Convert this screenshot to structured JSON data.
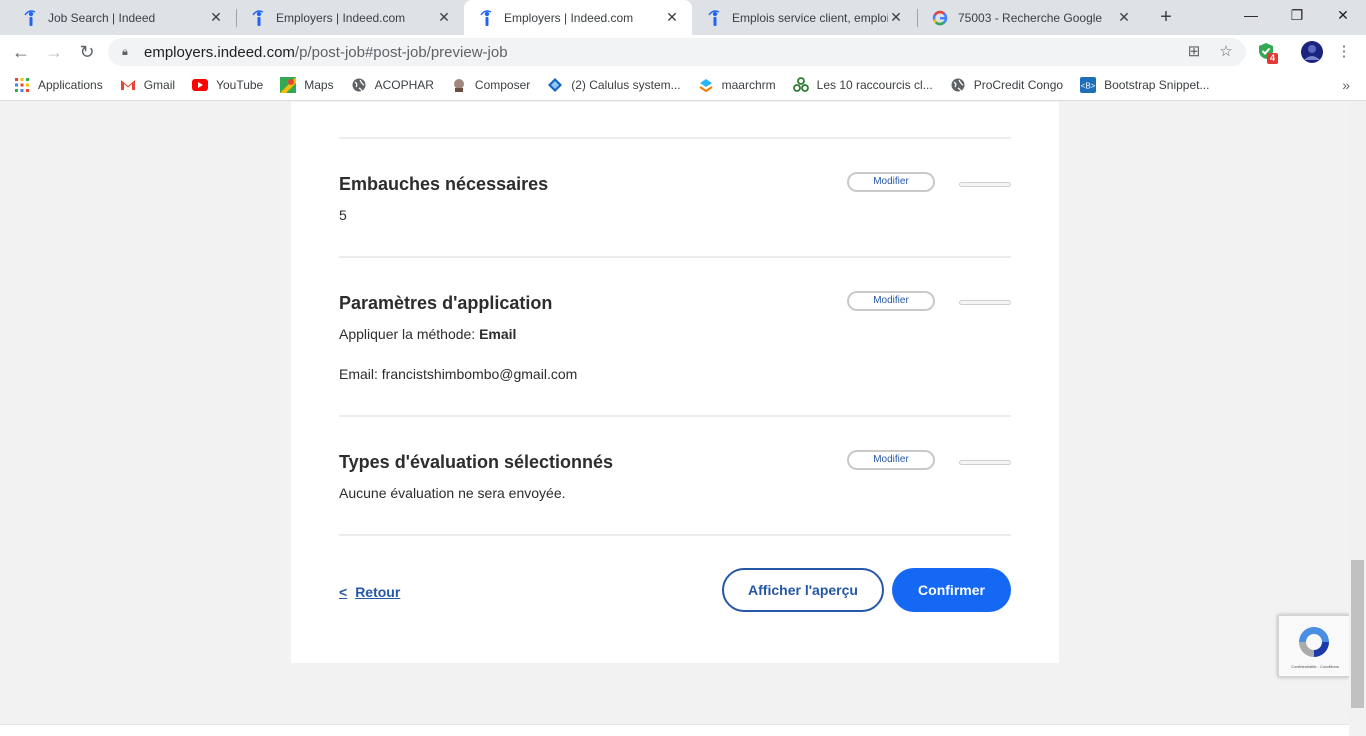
{
  "browser": {
    "tabs": [
      {
        "title": "Job Search | Indeed",
        "icon": "indeed-icon"
      },
      {
        "title": "Employers | Indeed.com",
        "icon": "indeed-icon"
      },
      {
        "title": "Employers | Indeed.com",
        "icon": "indeed-icon",
        "active": true
      },
      {
        "title": "Emplois service client, emploi | ",
        "icon": "indeed-icon"
      },
      {
        "title": "75003 - Recherche Google",
        "icon": "google-icon"
      }
    ],
    "url_host": "employers.indeed.com",
    "url_path": "/p/post-job#post-job/preview-job",
    "extension_badge": "4"
  },
  "bookmarks": [
    {
      "label": "Applications",
      "icon": "apps-grid-icon"
    },
    {
      "label": "Gmail",
      "icon": "gmail-icon"
    },
    {
      "label": "YouTube",
      "icon": "youtube-icon"
    },
    {
      "label": "Maps",
      "icon": "maps-icon"
    },
    {
      "label": "ACOPHAR",
      "icon": "globe-icon"
    },
    {
      "label": "Composer",
      "icon": "composer-icon"
    },
    {
      "label": "(2) Calulus system...",
      "icon": "calculus-icon"
    },
    {
      "label": "maarchrm",
      "icon": "maarch-icon"
    },
    {
      "label": "Les 10 raccourcis cl...",
      "icon": "shortcut-icon"
    },
    {
      "label": "ProCredit Congo",
      "icon": "globe-icon"
    },
    {
      "label": "Bootstrap Snippet...",
      "icon": "bootstrap-icon"
    }
  ],
  "sections": [
    {
      "title": "Embauches nécessaires",
      "lines": [
        "5"
      ],
      "edit_label": "Modifier"
    },
    {
      "title": "Paramètres d'application",
      "method_label": "Appliquer la méthode: ",
      "method_value": "Email",
      "email_line": "Email: francistshimbombo@gmail.com",
      "edit_label": "Modifier"
    },
    {
      "title": "Types d'évaluation sélectionnés",
      "lines": [
        "Aucune évaluation ne sera envoyée."
      ],
      "edit_label": "Modifier"
    }
  ],
  "footer": {
    "back_label": "Retour",
    "preview_label": "Afficher l'aperçu",
    "confirm_label": "Confirmer"
  },
  "recaptcha": {
    "terms": "Confidentialité - Conditions"
  },
  "colors": {
    "primary": "#1468f3",
    "link": "#2557a7"
  }
}
